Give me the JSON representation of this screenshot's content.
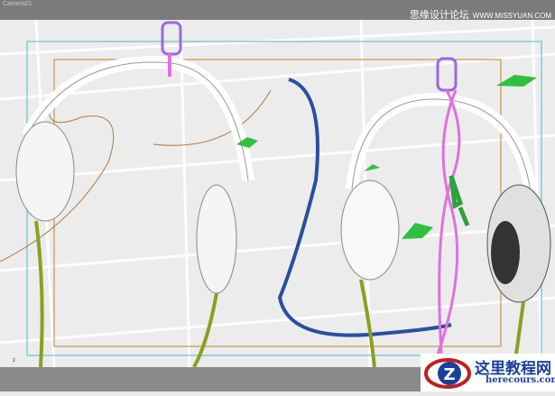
{
  "viewport": {
    "label": "Camera01",
    "axis_label": "z"
  },
  "watermark_top": {
    "text": "思缘设计论坛",
    "url": "WWW.MISSYUAN.COM"
  },
  "watermark_logo": {
    "text": "这里教程网",
    "url": "herecours.com",
    "letter": "Z"
  },
  "colors": {
    "safe_frame": "#5fc8d0",
    "render_frame": "#c8964a",
    "cable_blue": "#2a4fa0",
    "cable_pink": "#e070e0",
    "cable_green": "#8aa020",
    "helper_green": "#30c040",
    "mic_purple": "#9a6ae0"
  }
}
